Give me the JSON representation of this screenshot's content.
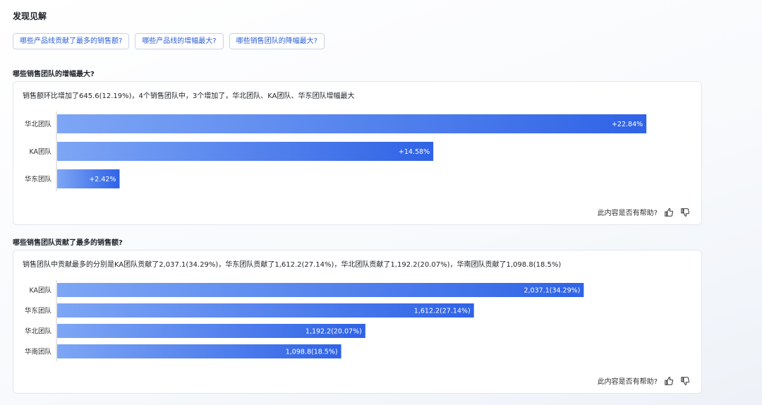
{
  "page": {
    "title": "发现见解",
    "chips": [
      "哪些产品线贡献了最多的销售额?",
      "哪些产品线的增幅最大?",
      "哪些销售团队的降幅最大?"
    ]
  },
  "sections": [
    {
      "title": "哪些销售团队的增幅最大?",
      "summary": "销售额环比增加了645.6(12.19%)，4个销售团队中，3个增加了，华北团队、KA团队、华东团队增幅最大",
      "feedback_label": "此内容是否有帮助?"
    },
    {
      "title": "哪些销售团队贡献了最多的销售额?",
      "summary": "销售团队中贡献最多的分别是KA团队贡献了2,037.1(34.29%)，华东团队贡献了1,612.2(27.14%)，华北团队贡献了1,192.2(20.07%)，华南团队贡献了1,098.8(18.5%)",
      "feedback_label": "此内容是否有帮助?"
    }
  ],
  "chart_data": [
    {
      "type": "bar",
      "orientation": "horizontal",
      "categories": [
        "华北团队",
        "KA团队",
        "华东团队"
      ],
      "values": [
        22.84,
        14.58,
        2.42
      ],
      "labels": [
        "+22.84%",
        "+14.58%",
        "+2.42%"
      ],
      "xlim": [
        0,
        23
      ]
    },
    {
      "type": "bar",
      "orientation": "horizontal",
      "categories": [
        "KA团队",
        "华东团队",
        "华北团队",
        "华南团队"
      ],
      "values": [
        2037.1,
        1612.2,
        1192.2,
        1098.8
      ],
      "labels": [
        "2,037.1(34.29%)",
        "1,612.2(27.14%)",
        "1,192.2(20.07%)",
        "1,098.8(18.5%)"
      ],
      "xlim": [
        0,
        2500
      ]
    }
  ],
  "colors": {
    "bar_start": "#7ea6f5",
    "bar_end": "#2f63e6",
    "axis": "#c8ccd3",
    "chip_text": "#2d5fd6"
  }
}
